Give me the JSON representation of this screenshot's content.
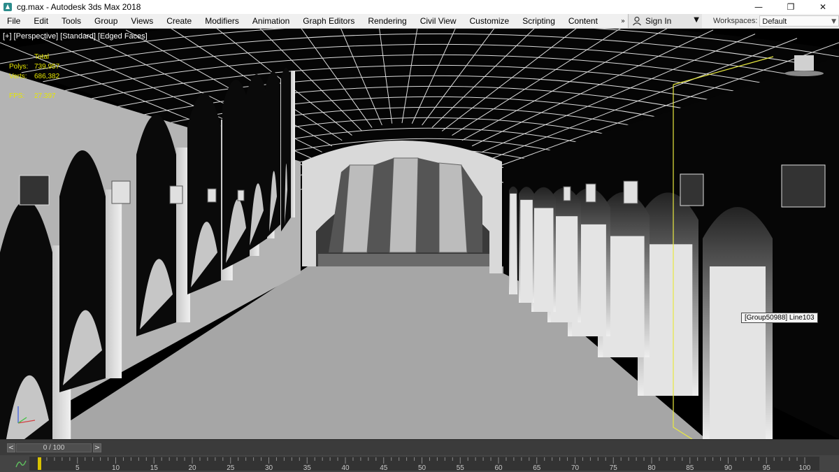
{
  "window": {
    "title": "cg.max - Autodesk 3ds Max 2018",
    "app_icon": "3ds-max-logo-icon",
    "controls": [
      "minimize-icon",
      "restore-icon",
      "close-icon"
    ],
    "minimize_glyph": "—",
    "restore_glyph": "❐",
    "close_glyph": "✕"
  },
  "menubar": {
    "items": [
      "File",
      "Edit",
      "Tools",
      "Group",
      "Views",
      "Create",
      "Modifiers",
      "Animation",
      "Graph Editors",
      "Rendering",
      "Civil View",
      "Customize",
      "Scripting",
      "Content"
    ],
    "overflow_glyph": "»",
    "sign_in": {
      "label": "Sign In",
      "icon": "user-icon",
      "arrow": "▼"
    },
    "workspaces": {
      "label": "Workspaces:",
      "value": "Default",
      "caret": "▼"
    }
  },
  "viewport": {
    "label": [
      "[+]",
      "[Perspective]",
      "[Standard]",
      "[Edged Faces]"
    ],
    "stats": {
      "header": "Total",
      "polys_label": "Polys:",
      "polys": "739,957",
      "verts_label": "Verts:",
      "verts": "686,382",
      "fps_label": "FPS:",
      "fps": "27.397"
    },
    "tooltip": "[Group50988] Line103",
    "axis_gizmo": "axis-tripod-icon"
  },
  "time_slider": {
    "value": "0 / 100",
    "prev": "<",
    "next": ">",
    "current_frame": 0,
    "total_frames": 100
  },
  "track_bar": {
    "ticks": [
      "0",
      "5",
      "10",
      "15",
      "20",
      "25",
      "30",
      "35",
      "40",
      "45",
      "50",
      "55",
      "60",
      "65",
      "70",
      "75",
      "80",
      "85",
      "90",
      "95",
      "100"
    ],
    "icon": "mini-curve-editor-icon"
  },
  "colors": {
    "accent_yellow": "#e6e600",
    "menubar_bg": "#f0f0f0",
    "viewport_bg": "#000000",
    "selection_outline": "#e8e840"
  }
}
